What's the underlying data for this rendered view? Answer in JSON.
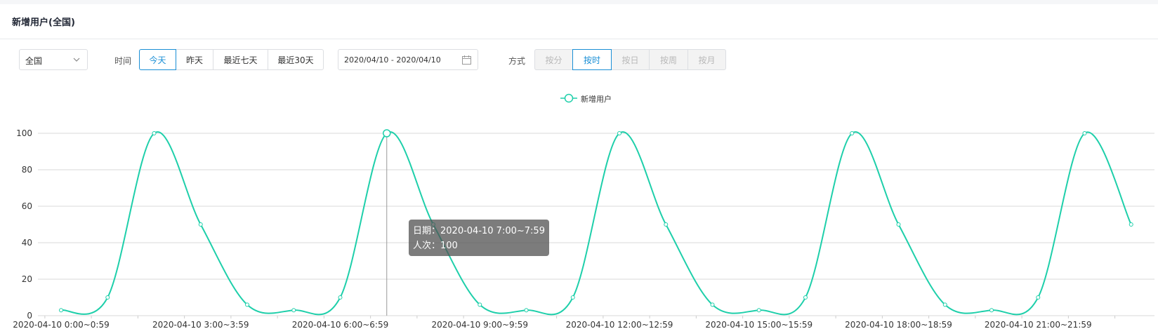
{
  "card": {
    "title": "新增用户(全国)"
  },
  "filters": {
    "region": {
      "value": "全国",
      "icon": "chevron-down-icon"
    },
    "time_label": "时间",
    "time_buttons": [
      "今天",
      "昨天",
      "最近七天",
      "最近30天"
    ],
    "time_active": 0,
    "date_range": "2020/04/10 - 2020/04/10",
    "date_icon": "calendar-icon",
    "mode_label": "方式",
    "mode_buttons": [
      "按分",
      "按时",
      "按日",
      "按周",
      "按月"
    ],
    "mode_active": 1
  },
  "colors": {
    "series": "#1ecfaa",
    "accent": "#1a8fd6",
    "grid": "#d9d9d9"
  },
  "tooltip": {
    "date_line": "日期：2020-04-10 7:00~7:59",
    "count_line": "人次：100"
  },
  "chart_data": {
    "type": "line",
    "title": "",
    "legend": [
      "新增用户"
    ],
    "legend_position": "top-center",
    "ylim": [
      0,
      100
    ],
    "y_ticks": [
      "0",
      "20",
      "40",
      "60",
      "80",
      "100"
    ],
    "grid": true,
    "x_tick_labels": [
      "2020-04-10 0:00~0:59",
      "2020-04-10 3:00~3:59",
      "2020-04-10 6:00~6:59",
      "2020-04-10 9:00~9:59",
      "2020-04-10 12:00~12:59",
      "2020-04-10 15:00~15:59",
      "2020-04-10 18:00~18:59",
      "2020-04-10 21:00~21:59"
    ],
    "series": [
      {
        "name": "新增用户",
        "values": [
          3,
          10,
          100,
          50,
          6,
          3,
          10,
          100,
          50,
          6,
          3,
          10,
          100,
          50,
          6,
          3,
          10,
          100,
          50,
          6,
          3,
          10,
          100,
          50
        ]
      }
    ],
    "highlight_index": 7
  }
}
